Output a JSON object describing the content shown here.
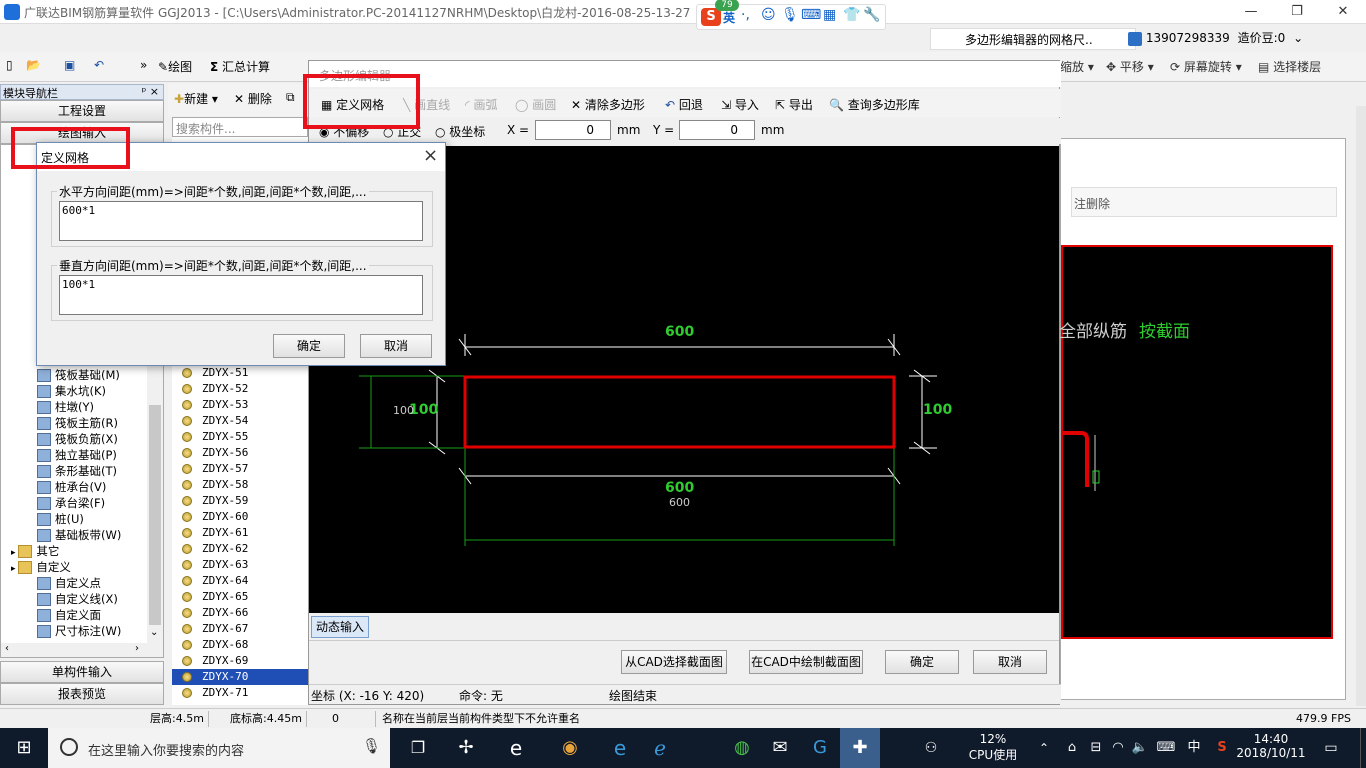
{
  "app": {
    "title": "广联达BIM钢筋算量软件 GGJ2013 - [C:\\Users\\Administrator.PC-20141127NRHM\\Desktop\\白龙村-2016-08-25-13-27",
    "badge": "79"
  },
  "ime": {
    "lang": "英"
  },
  "topbar": {
    "notice": "多边形编辑器的网格尺..",
    "phone": "13907298339",
    "coins": "造价豆:0"
  },
  "main_toolbar": {
    "draw": "绘图",
    "sum": "汇总计算",
    "zoom": "缩放",
    "pan": "平移",
    "rotate": "屏幕旋转",
    "select_floor": "选择楼层"
  },
  "nav": {
    "header": "模块导航栏",
    "pin": "ᵖ ×",
    "project_settings": "工程设置",
    "drawing_input": "绘图输入",
    "single_input": "单构件输入",
    "report_preview": "报表预览",
    "tree": [
      {
        "label": "筏板基础(M)",
        "indent": 2
      },
      {
        "label": "集水坑(K)",
        "indent": 2
      },
      {
        "label": "柱墩(Y)",
        "indent": 2
      },
      {
        "label": "筏板主筋(R)",
        "indent": 2
      },
      {
        "label": "筏板负筋(X)",
        "indent": 2
      },
      {
        "label": "独立基础(P)",
        "indent": 2
      },
      {
        "label": "条形基础(T)",
        "indent": 2
      },
      {
        "label": "桩承台(V)",
        "indent": 2
      },
      {
        "label": "承台梁(F)",
        "indent": 2
      },
      {
        "label": "桩(U)",
        "indent": 2
      },
      {
        "label": "基础板带(W)",
        "indent": 2
      },
      {
        "label": "其它",
        "indent": 1
      },
      {
        "label": "自定义",
        "indent": 1
      },
      {
        "label": "自定义点",
        "indent": 2
      },
      {
        "label": "自定义线(X)",
        "indent": 2
      },
      {
        "label": "自定义面",
        "indent": 2
      },
      {
        "label": "尺寸标注(W)",
        "indent": 2
      }
    ]
  },
  "mid": {
    "new": "新建",
    "delete": "删除",
    "search_placeholder": "搜索构件...",
    "items": [
      "ZDYX-51",
      "ZDYX-52",
      "ZDYX-53",
      "ZDYX-54",
      "ZDYX-55",
      "ZDYX-56",
      "ZDYX-57",
      "ZDYX-58",
      "ZDYX-59",
      "ZDYX-60",
      "ZDYX-61",
      "ZDYX-62",
      "ZDYX-63",
      "ZDYX-64",
      "ZDYX-65",
      "ZDYX-66",
      "ZDYX-67",
      "ZDYX-68",
      "ZDYX-69",
      "ZDYX-70",
      "ZDYX-71"
    ],
    "selected": "ZDYX-70"
  },
  "poly": {
    "title": "多边形编辑器",
    "define_grid": "定义网格",
    "draw_line": "画直线",
    "draw_arc": "画弧",
    "draw_circle": "画圆",
    "clear_poly": "清除多边形",
    "undo": "回退",
    "import": "导入",
    "export": "导出",
    "query_lib": "查询多边形库",
    "opt_no_offset": "不偏移",
    "opt_ortho": "正交",
    "opt_polar": "极坐标",
    "x_label": "X =",
    "x_value": "0",
    "y_label": "Y =",
    "y_value": "0",
    "unit": "mm",
    "dim_top": "600",
    "dim_bottom": "600",
    "dim_bottom_small": "600",
    "dim_left": "100",
    "dim_left_small": "100",
    "dim_right": "100",
    "dynamic_input": "动态输入",
    "btn_from_cad": "从CAD选择截面图",
    "btn_draw_in_cad": "在CAD中绘制截面图",
    "btn_ok": "确定",
    "btn_cancel": "取消",
    "status_coord": "坐标 (X: -16 Y: 420)",
    "status_cmd": "命令: 无",
    "status_msg": "绘图结束"
  },
  "right": {
    "delete": "删除",
    "text_a": "全部纵筋",
    "text_b": "按截面"
  },
  "dialog": {
    "title": "定义网格",
    "h_label": "水平方向间距(mm)=>间距*个数,间距,间距*个数,间距,...",
    "h_value": "600*1",
    "v_label": "垂直方向间距(mm)=>间距*个数,间距,间距*个数,间距,...",
    "v_value": "100*1",
    "ok": "确定",
    "cancel": "取消"
  },
  "status": {
    "floor_height": "层高:4.5m",
    "bottom_height": "底标高:4.45m",
    "zero": "0",
    "message": "名称在当前层当前构件类型下不允许重名",
    "fps": "479.9 FPS"
  },
  "taskbar": {
    "search_placeholder": "在这里输入你要搜索的内容",
    "cpu_pct": "12%",
    "cpu_label": "CPU使用",
    "lang": "中",
    "time": "14:40",
    "date": "2018/10/11"
  },
  "colors": {
    "accent": "#1e6fd9",
    "highlight": "#e8111b",
    "dim_green": "#2ecc2e",
    "rect_red": "#e00000"
  }
}
